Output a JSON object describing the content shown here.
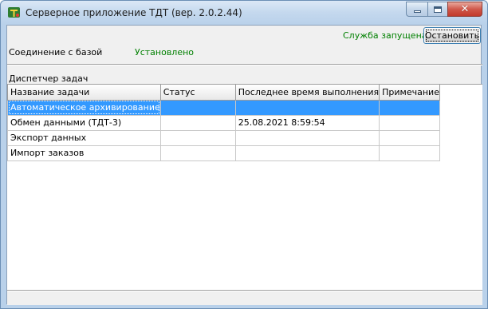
{
  "window": {
    "title": "Серверное приложение ТДТ (вер. 2.0.2.44)",
    "icons": {
      "app": "app-logo-icon",
      "minimize": "minimize-icon",
      "maximize": "maximize-icon",
      "close": "close-icon"
    },
    "close_glyph": "✕"
  },
  "service": {
    "status_text": "Служба запущена",
    "status_color": "#008000",
    "stop_button_label": "Остановить"
  },
  "connection": {
    "label": "Соединение с базой",
    "value": "Установлено"
  },
  "dispatcher": {
    "label": "Диспетчер задач",
    "columns": [
      "Название задачи",
      "Статус",
      "Последнее время выполнения",
      "Примечание"
    ],
    "rows": [
      {
        "name": "Автоматическое архивирование",
        "status": "",
        "last_run": "",
        "note": "",
        "selected": true
      },
      {
        "name": "Обмен данными (ТДТ-3)",
        "status": "",
        "last_run": "25.08.2021 8:59:54",
        "note": "",
        "selected": false
      },
      {
        "name": "Экспорт данных",
        "status": "",
        "last_run": "",
        "note": "",
        "selected": false
      },
      {
        "name": "Импорт заказов",
        "status": "",
        "last_run": "",
        "note": "",
        "selected": false
      }
    ],
    "selection_color": "#3399ff"
  }
}
